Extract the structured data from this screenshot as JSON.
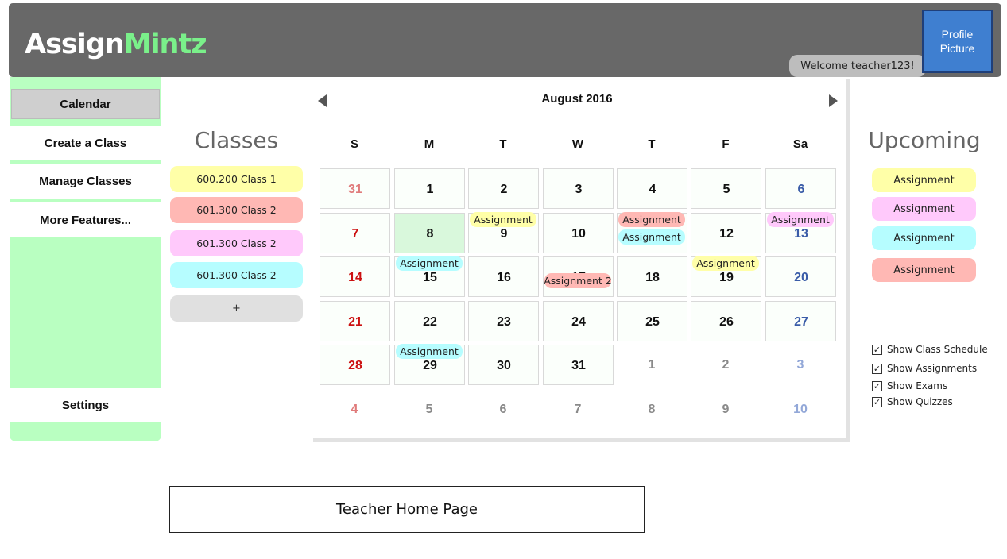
{
  "header": {
    "logo_part1": "Assign",
    "logo_part2": "Mintz",
    "welcome": "Welcome teacher123!",
    "profile_picture": "Profile Picture"
  },
  "sidebar": {
    "items": [
      {
        "label": "Calendar",
        "active": true
      },
      {
        "label": "Create a Class"
      },
      {
        "label": "Manage Classes"
      },
      {
        "label": "More Features..."
      },
      {
        "label": "Settings"
      }
    ]
  },
  "classes": {
    "title": "Classes",
    "items": [
      {
        "label": "600.200 Class 1",
        "color": "#ffffa8"
      },
      {
        "label": "601.300 Class 2",
        "color": "#ffb8b4"
      },
      {
        "label": "601.300 Class 2",
        "color": "#ffc9fb"
      },
      {
        "label": "601.300 Class 2",
        "color": "#b6fdff"
      }
    ],
    "add_label": "+"
  },
  "calendar": {
    "title": "August 2016",
    "weekdays": [
      "S",
      "M",
      "T",
      "W",
      "T",
      "F",
      "Sa"
    ],
    "weeks": [
      [
        {
          "d": "31",
          "o": true
        },
        {
          "d": "1"
        },
        {
          "d": "2"
        },
        {
          "d": "3"
        },
        {
          "d": "4"
        },
        {
          "d": "5"
        },
        {
          "d": "6"
        }
      ],
      [
        {
          "d": "7"
        },
        {
          "d": "8",
          "sel": true
        },
        {
          "d": "9"
        },
        {
          "d": "10"
        },
        {
          "d": "11"
        },
        {
          "d": "12"
        },
        {
          "d": "13"
        }
      ],
      [
        {
          "d": "14"
        },
        {
          "d": "15"
        },
        {
          "d": "16"
        },
        {
          "d": "17"
        },
        {
          "d": "18"
        },
        {
          "d": "19"
        },
        {
          "d": "20"
        }
      ],
      [
        {
          "d": "21"
        },
        {
          "d": "22"
        },
        {
          "d": "23"
        },
        {
          "d": "24"
        },
        {
          "d": "25"
        },
        {
          "d": "26"
        },
        {
          "d": "27"
        }
      ],
      [
        {
          "d": "28"
        },
        {
          "d": "29"
        },
        {
          "d": "30"
        },
        {
          "d": "31"
        },
        {
          "d": "1",
          "o": true,
          "blank": true
        },
        {
          "d": "2",
          "o": true,
          "blank": true
        },
        {
          "d": "3",
          "o": true,
          "blank": true
        }
      ],
      [
        {
          "d": "4",
          "o": true,
          "blank": true
        },
        {
          "d": "5",
          "o": true,
          "blank": true
        },
        {
          "d": "6",
          "o": true,
          "blank": true
        },
        {
          "d": "7",
          "o": true,
          "blank": true
        },
        {
          "d": "8",
          "o": true,
          "blank": true
        },
        {
          "d": "9",
          "o": true,
          "blank": true
        },
        {
          "d": "10",
          "o": true,
          "blank": true
        }
      ]
    ],
    "events": [
      {
        "week": 1,
        "day": 2,
        "slot": 0,
        "label": "Assignment",
        "color": "#ffffa8"
      },
      {
        "week": 1,
        "day": 4,
        "slot": 0,
        "label": "Assignment",
        "color": "#ffb8b4"
      },
      {
        "week": 1,
        "day": 4,
        "slot": 1,
        "label": "Assignment",
        "color": "#b6fdff"
      },
      {
        "week": 1,
        "day": 6,
        "slot": 0,
        "label": "Assignment",
        "color": "#ffc9fb"
      },
      {
        "week": 2,
        "day": 1,
        "slot": 0,
        "label": "Assignment",
        "color": "#b6fdff"
      },
      {
        "week": 2,
        "day": 3,
        "slot": 1,
        "label": "Assignment 2",
        "color": "#ffb8b4"
      },
      {
        "week": 2,
        "day": 5,
        "slot": 0,
        "label": "Assignment",
        "color": "#ffffa8"
      },
      {
        "week": 4,
        "day": 1,
        "slot": 0,
        "label": "Assignment",
        "color": "#b6fdff"
      }
    ]
  },
  "upcoming": {
    "title": "Upcoming",
    "items": [
      {
        "label": "Assignment",
        "color": "#ffffa8"
      },
      {
        "label": "Assignment",
        "color": "#ffc9fb"
      },
      {
        "label": "Assignment",
        "color": "#b6fdff"
      },
      {
        "label": "Assignment",
        "color": "#ffb8b4"
      }
    ]
  },
  "filters": [
    {
      "label": "Show Class Schedule",
      "checked": true
    },
    {
      "label": "Show Assignments",
      "checked": true
    },
    {
      "label": "Show Exams",
      "checked": true
    },
    {
      "label": "Show Quizzes",
      "checked": true
    }
  ],
  "footer": {
    "caption": "Teacher Home Page"
  }
}
